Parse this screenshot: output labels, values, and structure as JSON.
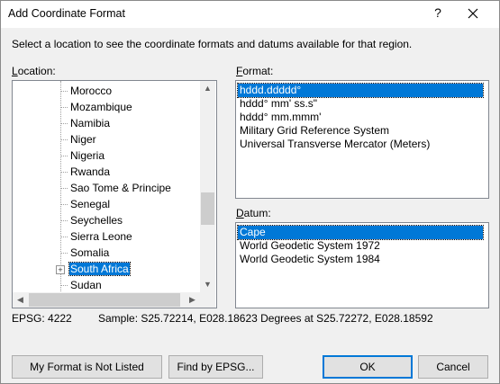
{
  "window": {
    "title": "Add Coordinate Format",
    "help_glyph": "?"
  },
  "instructions": "Select a location to see the coordinate formats and datums available for that region.",
  "location": {
    "label_access_key": "L",
    "label_rest": "ocation:",
    "items": [
      {
        "label": "Morocco",
        "selected": false,
        "expandable": false
      },
      {
        "label": "Mozambique",
        "selected": false,
        "expandable": false
      },
      {
        "label": "Namibia",
        "selected": false,
        "expandable": false
      },
      {
        "label": "Niger",
        "selected": false,
        "expandable": false
      },
      {
        "label": "Nigeria",
        "selected": false,
        "expandable": false
      },
      {
        "label": "Rwanda",
        "selected": false,
        "expandable": false
      },
      {
        "label": "Sao Tome & Principe",
        "selected": false,
        "expandable": false
      },
      {
        "label": "Senegal",
        "selected": false,
        "expandable": false
      },
      {
        "label": "Seychelles",
        "selected": false,
        "expandable": false
      },
      {
        "label": "Sierra Leone",
        "selected": false,
        "expandable": false
      },
      {
        "label": "Somalia",
        "selected": false,
        "expandable": false
      },
      {
        "label": "South Africa",
        "selected": true,
        "expandable": true
      },
      {
        "label": "Sudan",
        "selected": false,
        "expandable": false
      }
    ],
    "expander_glyph": "+",
    "scroll_up_glyph": "▲",
    "scroll_down_glyph": "▼",
    "scroll_left_glyph": "◀",
    "scroll_right_glyph": "▶"
  },
  "format": {
    "label_access_key": "F",
    "label_rest": "ormat:",
    "items": [
      {
        "label": "hddd.ddddd°",
        "selected": true
      },
      {
        "label": "hddd° mm' ss.s\"",
        "selected": false
      },
      {
        "label": "hddd° mm.mmm'",
        "selected": false
      },
      {
        "label": "Military Grid Reference System",
        "selected": false
      },
      {
        "label": "Universal Transverse Mercator (Meters)",
        "selected": false
      }
    ]
  },
  "datum": {
    "label_access_key": "D",
    "label_rest": "atum:",
    "items": [
      {
        "label": "Cape",
        "selected": true
      },
      {
        "label": "World Geodetic System 1972",
        "selected": false
      },
      {
        "label": "World Geodetic System 1984",
        "selected": false
      }
    ]
  },
  "status": {
    "epsg": "EPSG: 4222",
    "sample": "Sample: S25.72214, E028.18623 Degrees at S25.72272, E028.18592"
  },
  "buttons": {
    "not_listed": "My Format is Not Listed",
    "find_epsg": "Find by EPSG...",
    "ok": "OK",
    "cancel": "Cancel"
  },
  "colors": {
    "selection": "#0078d7",
    "dialog_bg": "#f0f0f0"
  }
}
